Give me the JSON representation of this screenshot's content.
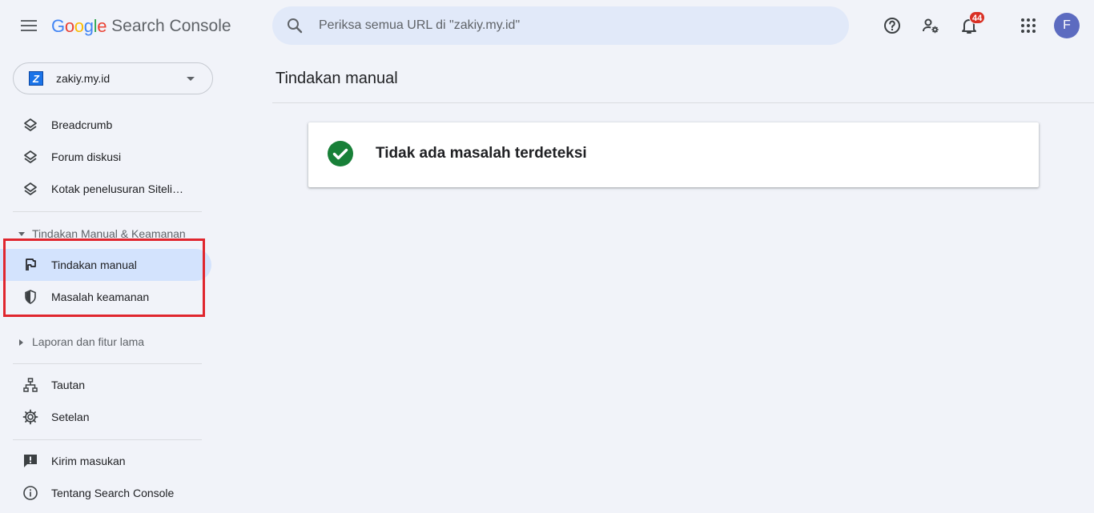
{
  "app": {
    "logo_letters": [
      "G",
      "o",
      "o",
      "g",
      "l",
      "e"
    ],
    "logo_colors": [
      "#4285F4",
      "#EA4335",
      "#FBBC05",
      "#4285F4",
      "#34A853",
      "#EA4335"
    ],
    "product_name": "Search Console"
  },
  "search": {
    "placeholder": "Periksa semua URL di \"zakiy.my.id\""
  },
  "header": {
    "notifications_count": "44",
    "avatar_letter": "F",
    "icons": [
      "menu-icon",
      "search-icon",
      "help-icon",
      "manage-users-icon",
      "notifications-icon",
      "apps-grid-icon"
    ]
  },
  "property": {
    "name": "zakiy.my.id",
    "logo_letter": "Z"
  },
  "sidebar": {
    "items_top": [
      {
        "label": "Breadcrumb",
        "icon": "layers-icon"
      },
      {
        "label": "Forum diskusi",
        "icon": "layers-icon"
      },
      {
        "label": "Kotak penelusuran Siteli…",
        "icon": "layers-icon"
      }
    ],
    "section_manual": "Tindakan Manual & Keamanan",
    "items_manual": [
      {
        "label": "Tindakan manual",
        "icon": "flag-icon",
        "active": true
      },
      {
        "label": "Masalah keamanan",
        "icon": "shield-icon",
        "active": false
      }
    ],
    "section_legacy": "Laporan dan fitur lama",
    "items_bottom": [
      {
        "label": "Tautan",
        "icon": "sitemap-icon"
      },
      {
        "label": "Setelan",
        "icon": "gear-icon"
      }
    ],
    "items_footer": [
      {
        "label": "Kirim masukan",
        "icon": "feedback-icon"
      },
      {
        "label": "Tentang Search Console",
        "icon": "info-icon"
      }
    ]
  },
  "main": {
    "title": "Tindakan manual",
    "status_message": "Tidak ada masalah terdeteksi",
    "status_color": "#188038"
  },
  "colors": {
    "active_bg": "#d3e3fd",
    "highlight": "#e0262e",
    "page_bg": "#f1f3f9"
  }
}
